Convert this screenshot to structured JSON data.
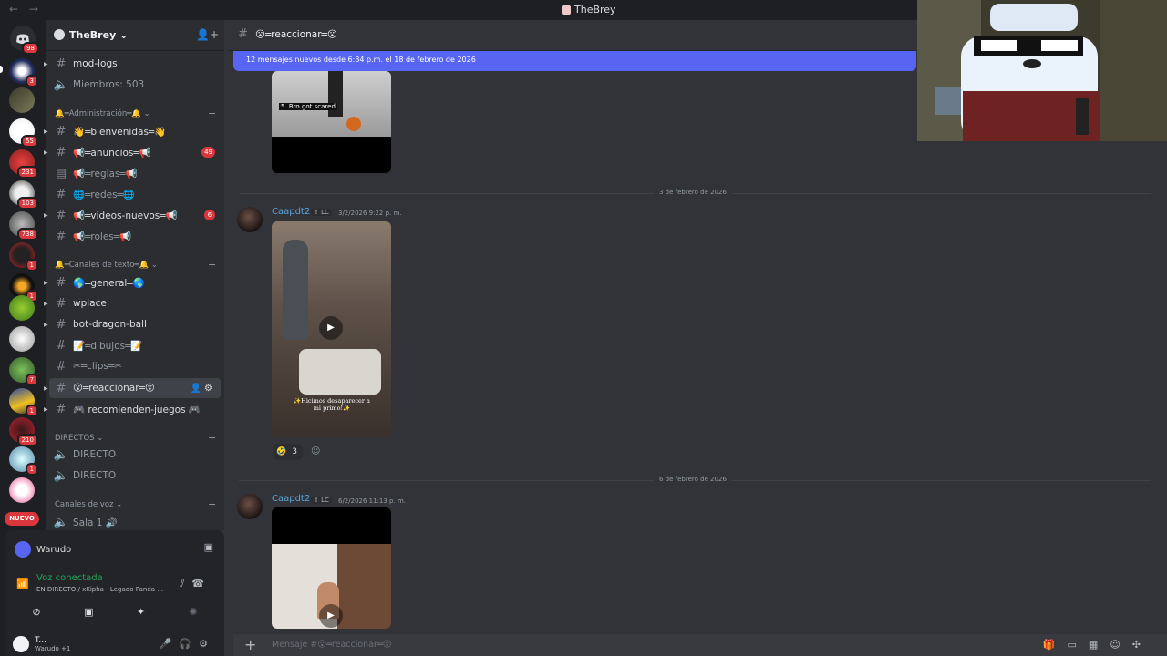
{
  "titlebar": {
    "nav": "← →",
    "title": "TheBrey"
  },
  "rail": {
    "badges": [
      "98",
      "3",
      "",
      "55",
      "231",
      "103",
      "738",
      "1",
      "1",
      "",
      "",
      "7",
      "1",
      "210",
      "1",
      "",
      ""
    ],
    "new_label": "NUEVO"
  },
  "server": {
    "name": "TheBrey"
  },
  "channels_top": [
    {
      "icon": "#",
      "label": "mod-logs"
    },
    {
      "icon": "🔊",
      "label": "Miembros: 503"
    }
  ],
  "categories": {
    "admin": "🔔═Administración═🔔",
    "text": "🔔═Canales de texto═🔔",
    "direct": "DIRECTOS",
    "voice": "Canales de voz"
  },
  "admin_channels": [
    {
      "label": "👋═bienvenidas═👋",
      "count": ""
    },
    {
      "label": "📢═anuncios═📢",
      "count": "49"
    },
    {
      "label": "📢═reglas═📢",
      "count": ""
    },
    {
      "label": "🌐═redes═🌐",
      "count": ""
    },
    {
      "label": "📢═videos-nuevos═📢",
      "count": "6"
    },
    {
      "label": "📢═roles═📢",
      "count": ""
    }
  ],
  "text_channels": [
    {
      "label": "🌎═general═🌎"
    },
    {
      "label": "wplace"
    },
    {
      "label": "bot-dragon-ball"
    },
    {
      "label": "📝═dibujos═📝"
    },
    {
      "label": "✂═clips═✂"
    },
    {
      "label": "😮═reaccionar═😮"
    },
    {
      "label": "🎮 recomienden-juegos 🎮"
    }
  ],
  "direct_channels": [
    "DIRECTO",
    "DIRECTO"
  ],
  "voice_channels": [
    "Sala 1 🔊"
  ],
  "panel": {
    "stream_user": "Warudo",
    "voice_status": "Voz conectada",
    "voice_sub": "EN DIRECTO / xKipha - Legado Panda ...",
    "username": "T...",
    "user_status": "Warudo +1"
  },
  "channel_header": {
    "name": "😮═reaccionar═😮"
  },
  "new_messages_bar": "12 mensajes nuevos desde 6:34 p.m. el 18 de febrero de 2026",
  "messages": [
    {
      "date_sep": "3 de febrero de 2026",
      "author": "Caapdt2",
      "tag": "✌ LC",
      "time": "3/2/2026 9:22 p. m.",
      "caption": "✨Hicimos desaparecer a mi primo!✨",
      "reaction_count": "3"
    },
    {
      "date_sep": "6 de febrero de 2026",
      "author": "Caapdt2",
      "tag": "✌ LC",
      "time": "6/2/2026 11:13 p. m."
    }
  ],
  "first_video_caption": "5. Bro got scared",
  "composer": {
    "placeholder": "Mensaje #😮═reaccionar═😮"
  },
  "colors": {
    "accent": "#5865f2",
    "danger": "#da373c",
    "online": "#23a55a",
    "bg": "#313338"
  }
}
